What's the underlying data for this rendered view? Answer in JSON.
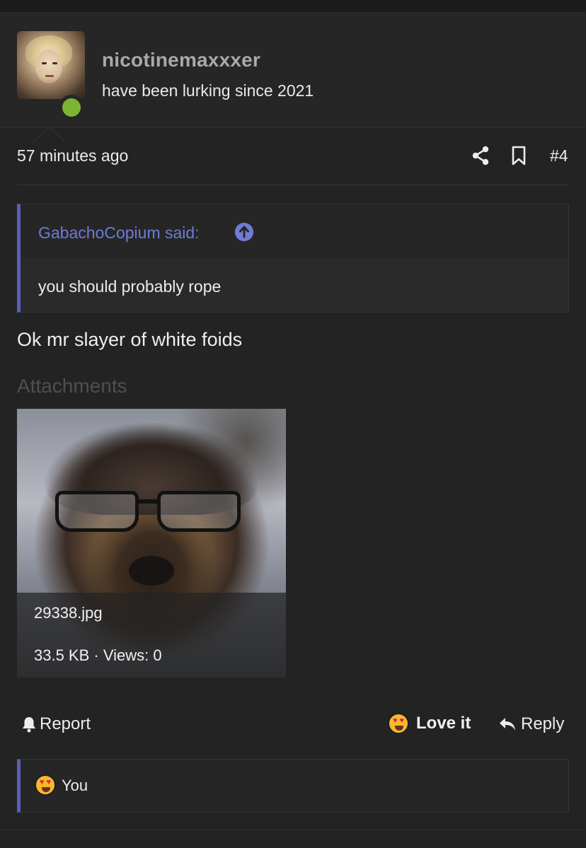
{
  "user": {
    "name": "nicotinemaxxxer",
    "title": "have been lurking since 2021",
    "online": true
  },
  "post": {
    "time": "57 minutes ago",
    "number": "#4",
    "body": "Ok mr slayer of white foids"
  },
  "quote": {
    "author": "GabachoCopium said:",
    "text": "you should probably rope"
  },
  "attachments": {
    "label": "Attachments",
    "items": [
      {
        "filename": "29338.jpg",
        "meta": "33.5 KB · Views: 0"
      }
    ]
  },
  "actions": {
    "report": "Report",
    "love": "Love it",
    "reply": "Reply"
  },
  "reactions": {
    "text": "You"
  },
  "colors": {
    "background": "#232323",
    "accent": "#6f7bd6",
    "online": "#7db431"
  },
  "icons": [
    "share-icon",
    "bookmark-icon",
    "arrow-up-circle-icon",
    "bell-icon",
    "heart-eyes-emoji-icon",
    "reply-arrow-icon"
  ]
}
